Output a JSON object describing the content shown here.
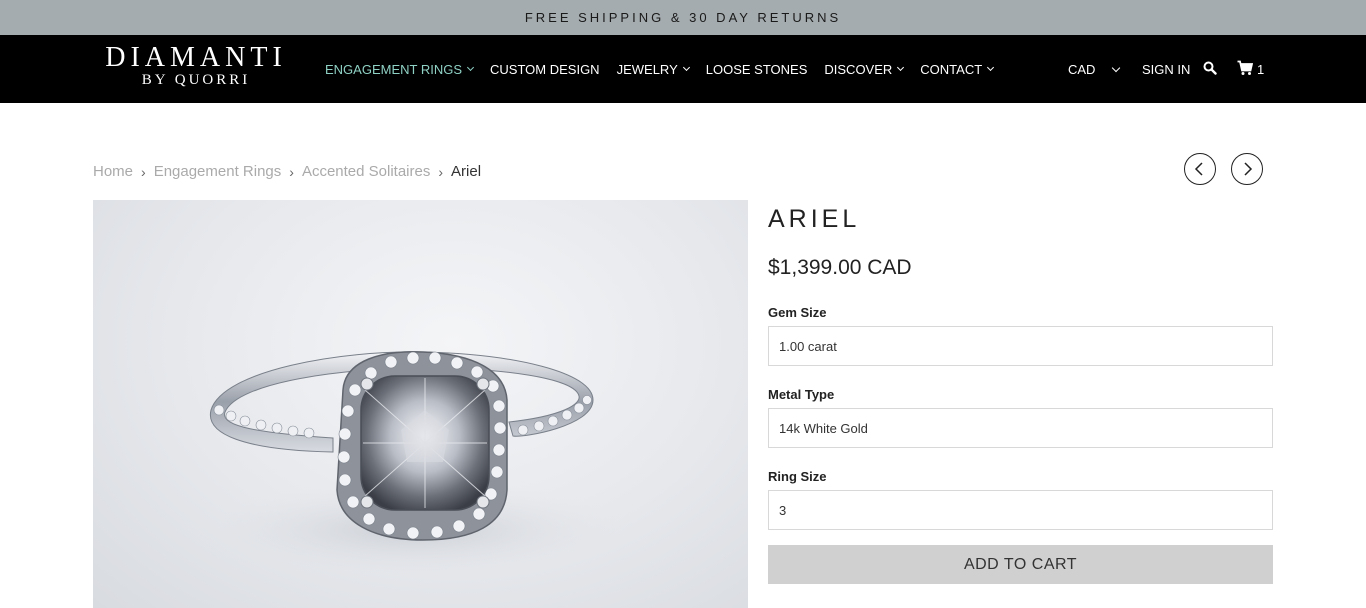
{
  "promo": {
    "text": "FREE SHIPPING & 30 DAY RETURNS"
  },
  "brand": {
    "line1": "DIAMANTI",
    "line2": "BY QUORRI"
  },
  "nav": {
    "items": [
      {
        "label": "ENGAGEMENT RINGS",
        "has_dropdown": true,
        "active": true
      },
      {
        "label": "CUSTOM DESIGN",
        "has_dropdown": false
      },
      {
        "label": "JEWELRY",
        "has_dropdown": true
      },
      {
        "label": "LOOSE STONES",
        "has_dropdown": false
      },
      {
        "label": "DISCOVER",
        "has_dropdown": true
      },
      {
        "label": "CONTACT",
        "has_dropdown": true
      }
    ],
    "currency": "CAD",
    "sign_in": "SIGN IN",
    "cart_count": "1",
    "icons": [
      "search-icon",
      "cart-icon",
      "chevron-down-icon"
    ],
    "active_color": "#8fd1c4"
  },
  "breadcrumb": {
    "items": [
      "Home",
      "Engagement Rings",
      "Accented Solitaires"
    ],
    "current": "Ariel",
    "separator": "›"
  },
  "product": {
    "title": "ARIEL",
    "price": "$1,399.00 CAD",
    "options": [
      {
        "label": "Gem Size",
        "value": "1.00 carat"
      },
      {
        "label": "Metal Type",
        "value": "14k White Gold"
      },
      {
        "label": "Ring Size",
        "value": "3"
      }
    ],
    "add_to_cart": "ADD TO CART"
  },
  "colors": {
    "promo_bg": "#a5acaf",
    "nav_bg": "#000000",
    "button_bg": "#d0d0d0"
  }
}
